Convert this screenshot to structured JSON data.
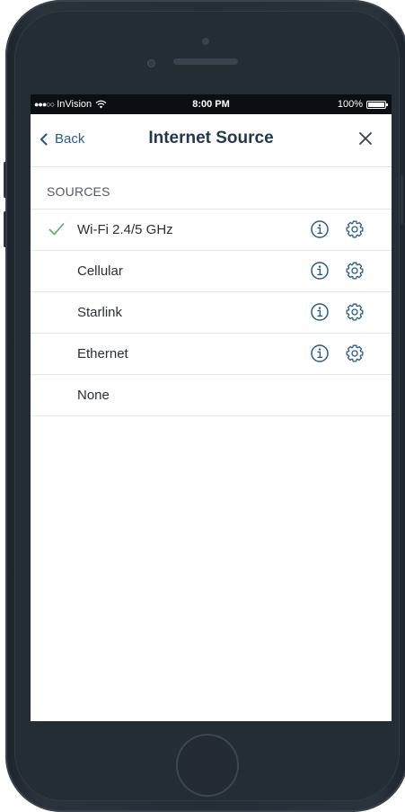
{
  "status_bar": {
    "carrier": "InVision",
    "time": "8:00 PM",
    "battery": "100%"
  },
  "nav": {
    "back_label": "Back",
    "title": "Internet Source"
  },
  "section": {
    "header": "SOURCES"
  },
  "sources": [
    {
      "label": "Wi-Fi 2.4/5 GHz",
      "selected": true,
      "has_actions": true
    },
    {
      "label": "Cellular",
      "selected": false,
      "has_actions": true
    },
    {
      "label": "Starlink",
      "selected": false,
      "has_actions": true
    },
    {
      "label": "Ethernet",
      "selected": false,
      "has_actions": true
    },
    {
      "label": "None",
      "selected": false,
      "has_actions": false
    }
  ],
  "colors": {
    "accent_blue": "#2a5a86",
    "check_green": "#5cab6a",
    "title": "#25394d"
  }
}
